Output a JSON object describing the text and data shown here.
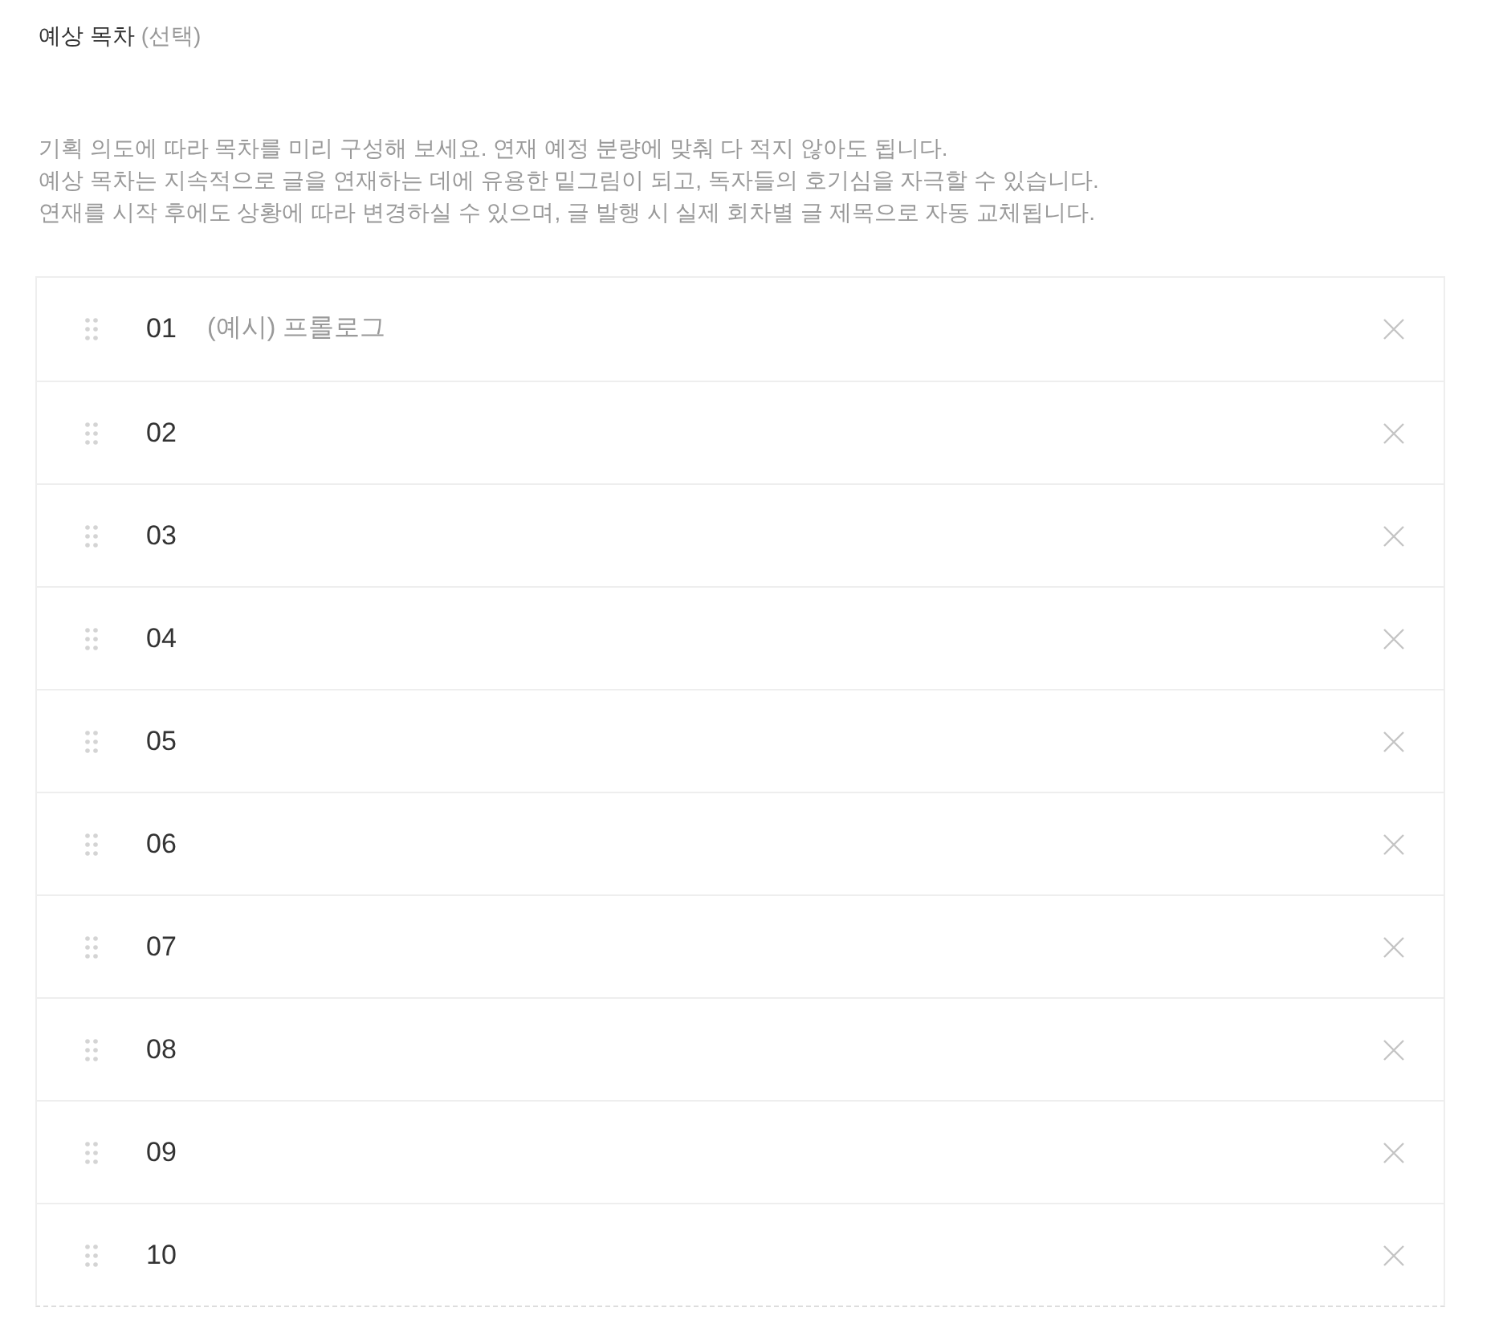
{
  "section": {
    "title": "예상 목차",
    "note": "(선택)"
  },
  "description": [
    "기획 의도에 따라 목차를 미리 구성해 보세요. 연재 예정 분량에 맞춰 다 적지 않아도 됩니다.",
    "예상 목차는 지속적으로 글을 연재하는 데에 유용한 밑그림이 되고, 독자들의 호기심을 자극할 수 있습니다.",
    "연재를 시작 후에도 상황에 따라 변경하실 수 있으며, 글 발행 시 실제 회차별 글 제목으로 자동 교체됩니다."
  ],
  "chapters": [
    {
      "number": "01",
      "placeholder": "(예시) 프롤로그"
    },
    {
      "number": "02"
    },
    {
      "number": "03"
    },
    {
      "number": "04"
    },
    {
      "number": "05"
    },
    {
      "number": "06"
    },
    {
      "number": "07"
    },
    {
      "number": "08"
    },
    {
      "number": "09"
    },
    {
      "number": "10"
    }
  ]
}
